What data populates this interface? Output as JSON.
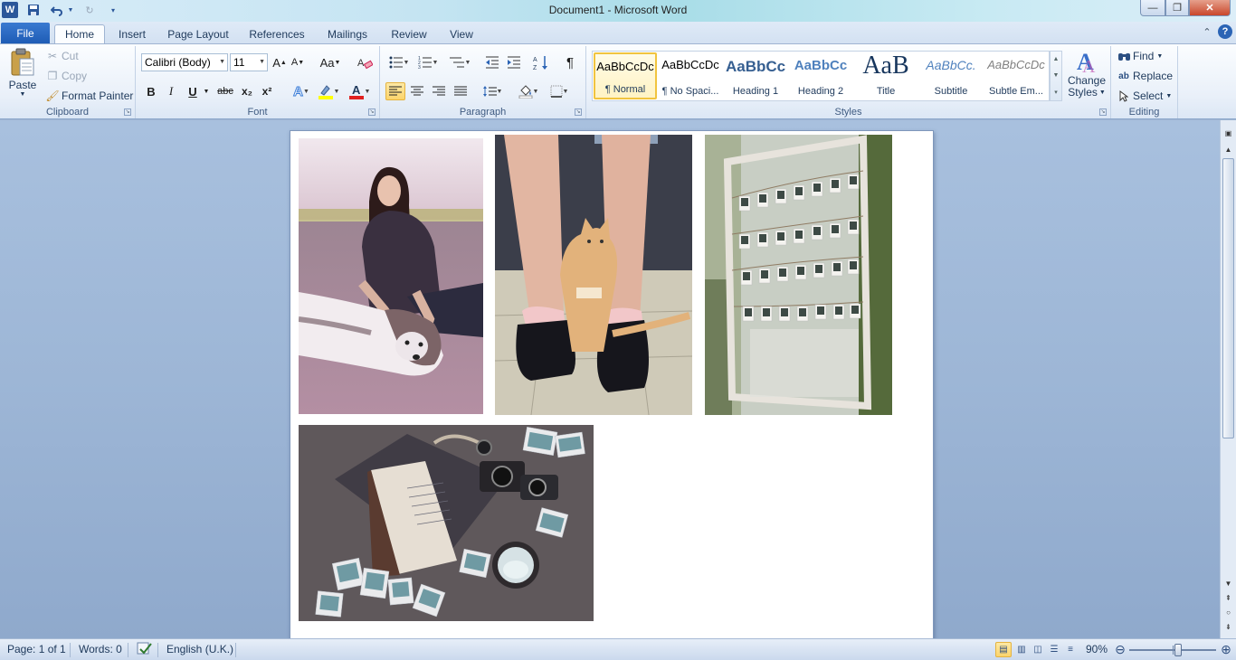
{
  "app": {
    "title": "Document1  -  Microsoft Word"
  },
  "tabs": {
    "file": "File",
    "items": [
      "Home",
      "Insert",
      "Page Layout",
      "References",
      "Mailings",
      "Review",
      "View"
    ]
  },
  "clipboard": {
    "paste": "Paste",
    "cut": "Cut",
    "copy": "Copy",
    "format_painter": "Format Painter",
    "label": "Clipboard"
  },
  "font": {
    "name": "Calibri (Body)",
    "size": "11",
    "label": "Font",
    "bold": "B",
    "italic": "I",
    "underline": "U",
    "strike": "abc",
    "subscript": "x₂",
    "superscript": "x²",
    "grow": "A",
    "shrink": "A",
    "change_case": "Aa"
  },
  "paragraph": {
    "label": "Paragraph",
    "pilcrow": "¶"
  },
  "styles": {
    "label": "Styles",
    "items": [
      {
        "preview": "AaBbCcDc",
        "name": "¶ Normal"
      },
      {
        "preview": "AaBbCcDc",
        "name": "¶ No Spaci..."
      },
      {
        "preview": "AaBbCc",
        "name": "Heading 1"
      },
      {
        "preview": "AaBbCc",
        "name": "Heading 2"
      },
      {
        "preview": "AaB",
        "name": "Title"
      },
      {
        "preview": "AaBbCc.",
        "name": "Subtitle"
      },
      {
        "preview": "AaBbCcDc",
        "name": "Subtle Em..."
      }
    ],
    "change_styles_1": "Change",
    "change_styles_2": "Styles"
  },
  "editing": {
    "label": "Editing",
    "find": "Find",
    "replace": "Replace",
    "select": "Select"
  },
  "status": {
    "page": "Page: 1 of 1",
    "words": "Words: 0",
    "language": "English (U.K.)",
    "zoom": "90%",
    "zoom_level": 0.56
  },
  "colors": {
    "accent": "#2b579a",
    "highlight": "#ffff00",
    "font_color": "#e02020"
  }
}
